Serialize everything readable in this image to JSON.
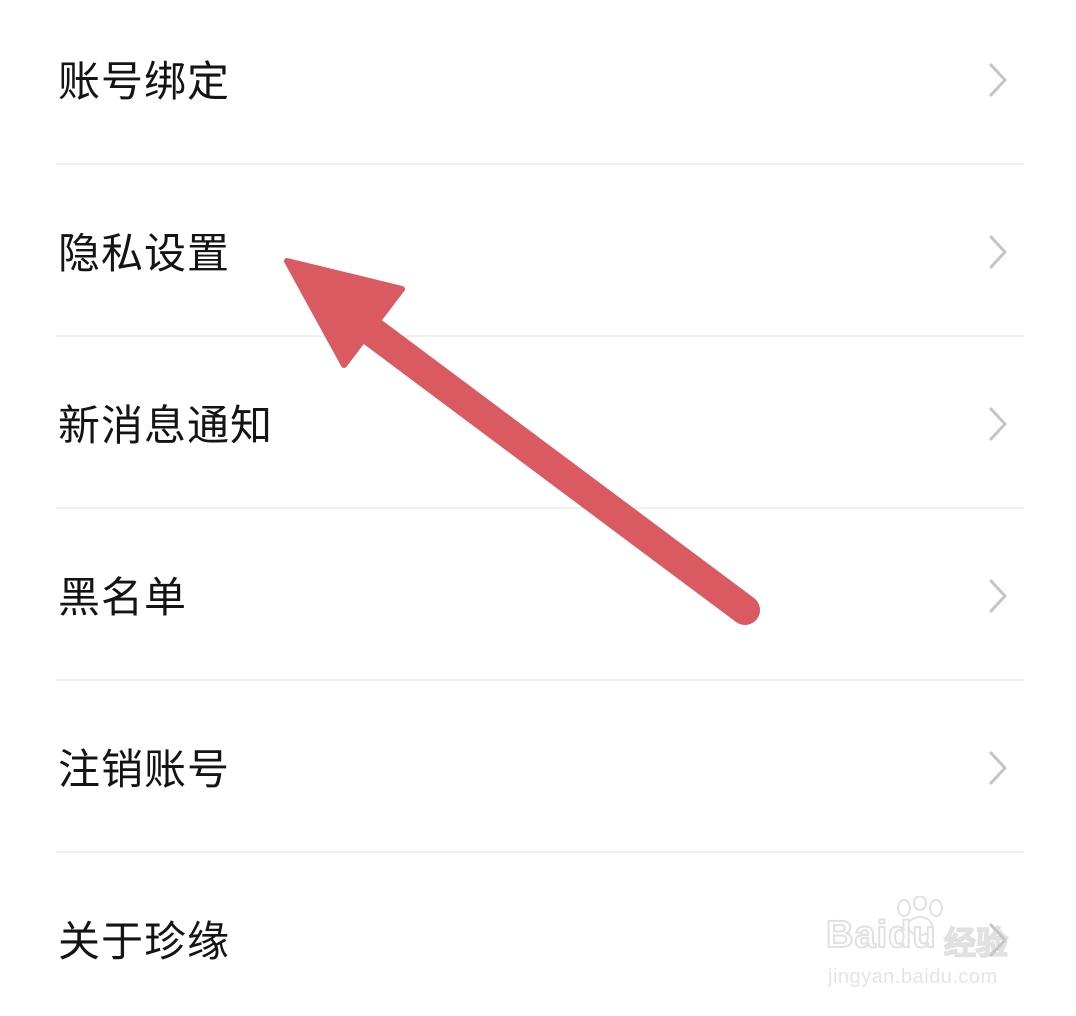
{
  "menu": {
    "items": [
      {
        "label": "账号绑定"
      },
      {
        "label": "隐私设置"
      },
      {
        "label": "新消息通知"
      },
      {
        "label": "黑名单"
      },
      {
        "label": "注销账号"
      },
      {
        "label": "关于珍缘"
      }
    ]
  },
  "icons": {
    "chevron": "chevron-right-icon",
    "annotation": "arrow-annotation-icon"
  },
  "colors": {
    "text": "#141414",
    "chevron": "#c4c4c4",
    "divider": "#f0f0f0",
    "arrow": "#d95a60"
  },
  "watermark": {
    "brand_latin": "Bai",
    "brand_du": "du",
    "brand_cn": "经验",
    "url": "jingyan.baidu.com"
  }
}
